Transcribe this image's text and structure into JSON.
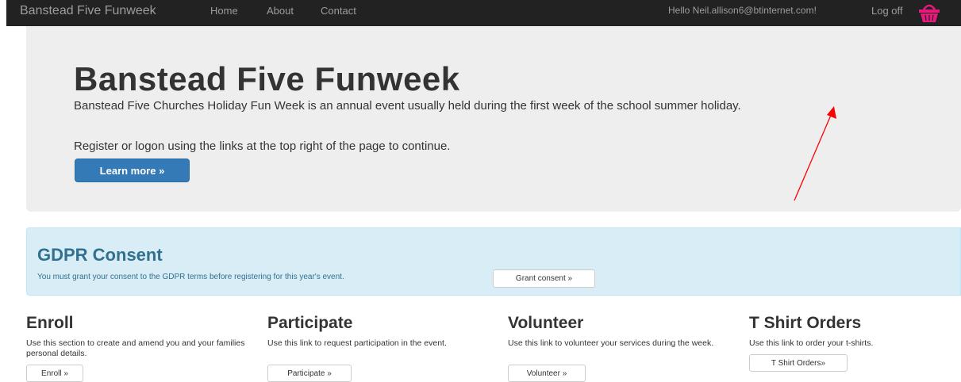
{
  "navbar": {
    "brand": "Banstead Five Funweek",
    "links": [
      "Home",
      "About",
      "Contact"
    ],
    "greeting": "Hello Neil.allison6@btinternet.com!",
    "logoff": "Log off",
    "cart_icon": "basket-icon",
    "cart_color": "#e8197d"
  },
  "jumbotron": {
    "title": "Banstead Five Funweek",
    "description": "Banstead Five Churches Holiday Fun Week is an annual event usually held during the first week of the school summer holiday.",
    "instruction": "Register or logon using the links at the top right of the page to continue.",
    "button_label": "Learn more »"
  },
  "gdpr": {
    "title": "GDPR Consent",
    "text": "You must grant your consent to the GDPR terms before registering for this year's event.",
    "button_label": "Grant consent »"
  },
  "sections": [
    {
      "title": "Enroll",
      "text": "Use this section to create and amend you and your families personal details.",
      "button_label": "Enroll »"
    },
    {
      "title": "Participate",
      "text": "Use this link to request participation in the event.",
      "button_label": "Participate »"
    },
    {
      "title": "Volunteer",
      "text": "Use this link to volunteer your services during the week.",
      "button_label": "Volunteer »"
    },
    {
      "title": "T Shirt Orders",
      "text": "Use this link to order your t-shirts.",
      "button_label": "T Shirt Orders»"
    }
  ],
  "colors": {
    "primary": "#337ab7",
    "navbar": "#222222",
    "jumbotron": "#eeeeee",
    "info_bg": "#d9edf7",
    "info_text": "#31708f",
    "annotation_arrow": "#ff0000"
  }
}
